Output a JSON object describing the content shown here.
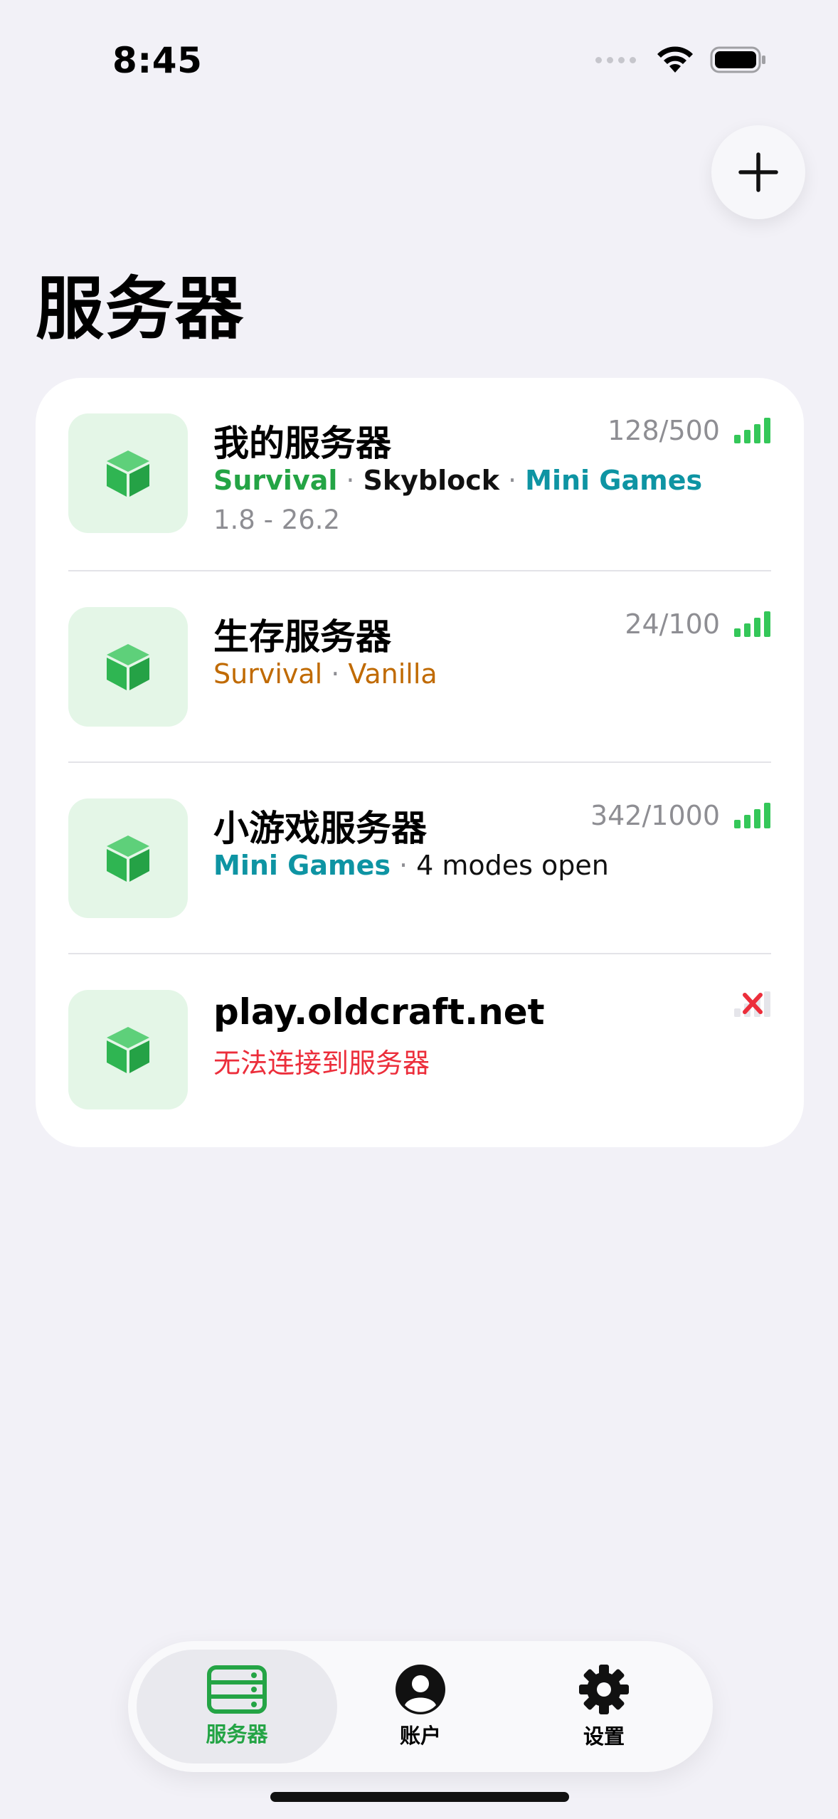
{
  "status_bar": {
    "time": "8:45"
  },
  "page": {
    "title": "服务器",
    "add_button_icon": "plus-icon"
  },
  "colors": {
    "accent_green": "#24a445",
    "teal": "#0e94a3",
    "orange": "#c06a00",
    "error_red": "#ec2e3b",
    "signal_green": "#34c759"
  },
  "servers": [
    {
      "name": "我的服务器",
      "tags": [
        "Survival",
        "Skyblock",
        "Mini Games"
      ],
      "version": "1.8 - 26.2",
      "players": "128/500",
      "signal": "full"
    },
    {
      "name": "生存服务器",
      "tags": [
        "Survival",
        "Vanilla"
      ],
      "players": "24/100",
      "signal": "full"
    },
    {
      "name": "小游戏服务器",
      "tags": [
        "Mini Games",
        "4 modes open"
      ],
      "players": "342/1000",
      "signal": "full"
    },
    {
      "name": "play.oldcraft.net",
      "error": "无法连接到服务器",
      "signal": "offline"
    }
  ],
  "separator": "·",
  "tabbar": {
    "items": [
      {
        "label": "服务器",
        "icon": "server-icon",
        "active": true
      },
      {
        "label": "账户",
        "icon": "account-icon",
        "active": false
      },
      {
        "label": "设置",
        "icon": "gear-icon",
        "active": false
      }
    ]
  }
}
